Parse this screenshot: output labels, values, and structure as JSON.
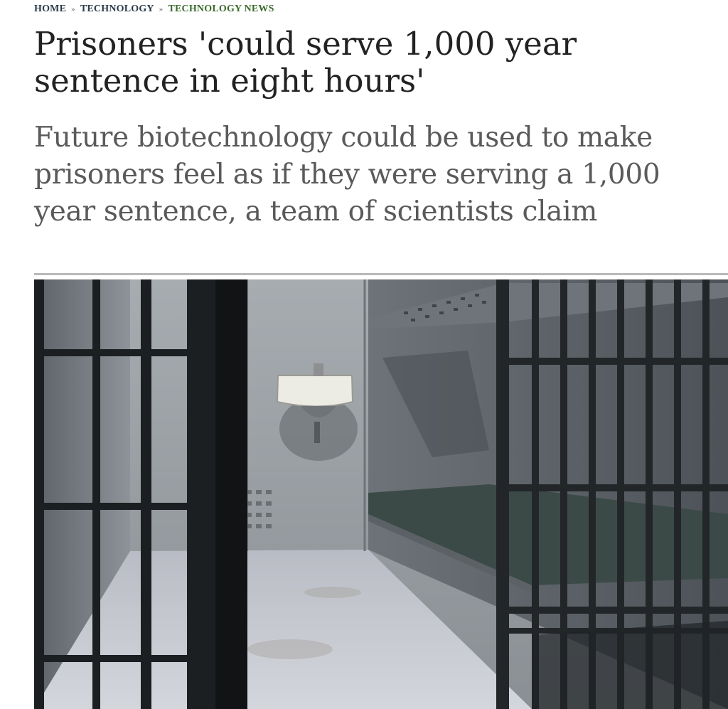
{
  "breadcrumb": {
    "items": [
      {
        "label": "HOME"
      },
      {
        "label": "TECHNOLOGY"
      },
      {
        "label": "TECHNOLOGY NEWS"
      }
    ],
    "separator": "»"
  },
  "article": {
    "headline": "Prisoners 'could serve 1,000 year sentence in eight hours'",
    "standfirst": "Future biotechnology could be used to make prisoners feel as if they were serving a 1,000 year sentence, a team of scientists claim"
  },
  "colors": {
    "breadcrumb_link": "#2a3a4a",
    "breadcrumb_active": "#3a6b2a",
    "headline": "#222222",
    "standfirst": "#5a5a5a",
    "rule": "#b9b9b9"
  }
}
